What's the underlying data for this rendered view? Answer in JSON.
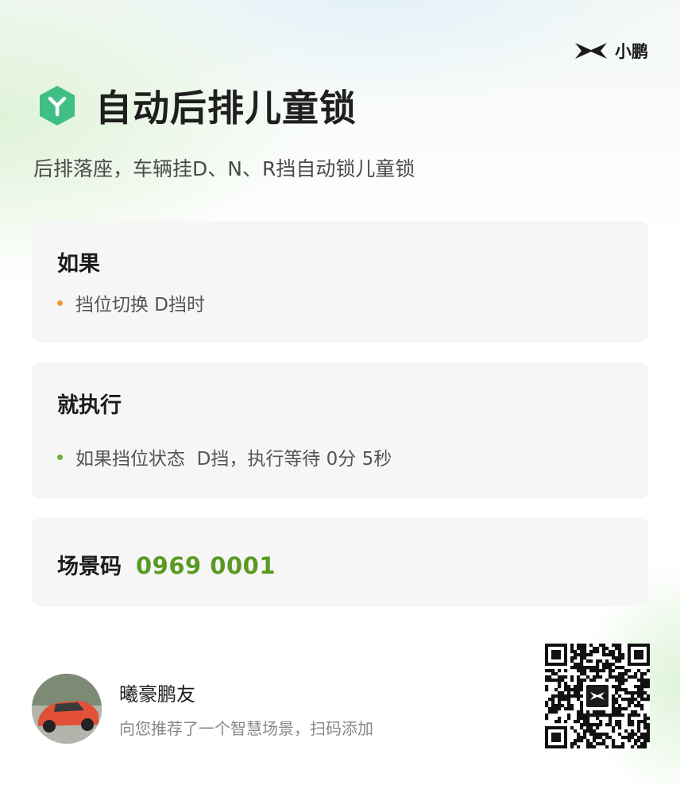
{
  "brand": {
    "name": "小鹏"
  },
  "header": {
    "title": "自动后排儿童锁",
    "subtitle": "后排落座，车辆挂D、N、R挡自动锁儿童锁"
  },
  "condition": {
    "heading": "如果",
    "items": [
      "挡位切换 D挡时"
    ]
  },
  "action": {
    "heading": "就执行",
    "items": [
      "如果挡位状态  D挡，执行等待 0分 5秒"
    ]
  },
  "scene_code": {
    "label": "场景码",
    "value": "0969 0001"
  },
  "sharer": {
    "name": "曦豪鹏友",
    "description": "向您推荐了一个智慧场景，扫码添加"
  },
  "colors": {
    "accent_green": "#5a9a23",
    "icon_green": "#3fbf86",
    "bullet_orange": "#f0952f",
    "bullet_green": "#66b33c"
  },
  "icons": {
    "brand_logo": "xpeng-x-logo",
    "title_icon": "y-hexagon-icon",
    "qr": "qr-code"
  }
}
